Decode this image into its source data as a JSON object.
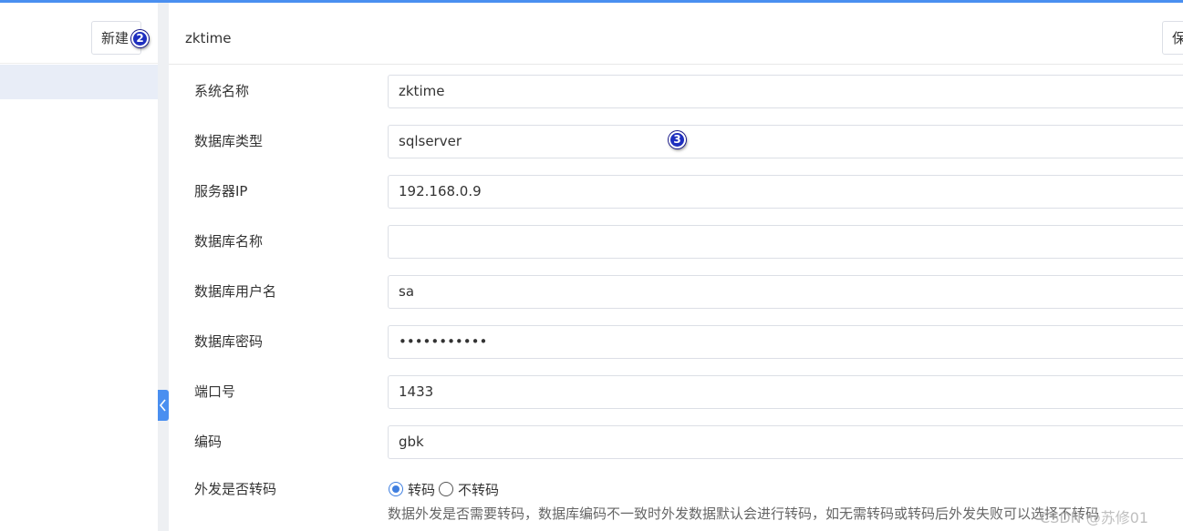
{
  "left_panel": {
    "new_button_label": "新建"
  },
  "record": {
    "title": "zktime",
    "save_button_label": "保"
  },
  "form": {
    "fields": [
      {
        "label": "系统名称",
        "value": "zktime"
      },
      {
        "label": "数据库类型",
        "value": "sqlserver"
      },
      {
        "label": "服务器IP",
        "value": "192.168.0.9"
      },
      {
        "label": "数据库名称",
        "value": ""
      },
      {
        "label": "数据库用户名",
        "value": "sa"
      },
      {
        "label": "数据库密码",
        "value": "•••••••••••"
      },
      {
        "label": "端口号",
        "value": "1433"
      },
      {
        "label": "编码",
        "value": "gbk"
      }
    ],
    "transcode": {
      "label": "外发是否转码",
      "options": [
        "转码",
        "不转码"
      ],
      "selected": "转码",
      "hint": "数据外发是否需要转码，数据库编码不一致时外发数据默认会进行转码，如无需转码或转码后外发失败可以选择不转码"
    }
  },
  "markers": {
    "new": "2",
    "db_type": "3"
  },
  "watermark": "CSDN @苏修01",
  "colors": {
    "accent": "#4a8ff0",
    "selected_row": "#e8edf7",
    "marker": "#1f2fbf"
  },
  "icons": {
    "collapse": "chevron-left-icon"
  }
}
